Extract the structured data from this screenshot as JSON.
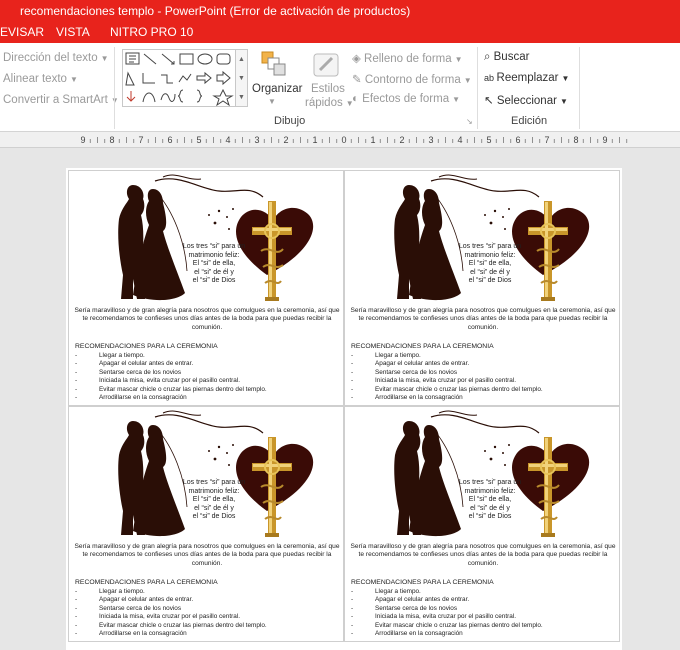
{
  "window": {
    "title": "recomendaciones templo - PowerPoint (Error de activación de productos)"
  },
  "menu": {
    "tabs": [
      "EVISAR",
      "VISTA",
      "NITRO PRO 10"
    ]
  },
  "ribbon": {
    "paragraph": {
      "text_direction": "Dirección del texto",
      "align_text": "Alinear texto",
      "convert_smartart": "Convertir a SmartArt"
    },
    "drawing": {
      "arrange": "Organizar",
      "quick_styles_1": "Estilos",
      "quick_styles_2": "rápidos",
      "shape_fill": "Relleno de forma",
      "shape_outline": "Contorno de forma",
      "shape_effects": "Efectos de forma",
      "group_label": "Dibujo"
    },
    "editing": {
      "find": "Buscar",
      "replace": "Reemplazar",
      "select": "Seleccionar",
      "group_label": "Edición"
    }
  },
  "ruler": {
    "labels": [
      "9",
      "8",
      "7",
      "6",
      "5",
      "4",
      "3",
      "2",
      "1",
      "0",
      "1",
      "2",
      "3",
      "4",
      "5",
      "6",
      "7",
      "8",
      "9"
    ]
  },
  "card": {
    "poem": [
      "Los tres “si” para un",
      "matrimonio feliz:",
      "El “si” de ella,",
      "el “si” de él y",
      "el “si” de Dios"
    ],
    "paragraph": "Sería maravilloso y de gran alegría para nosotros que comulgues en la ceremonia, así que te recomendamos te confieses unos días antes de la boda para que puedas recibir la comunión.",
    "rec_title": "RECOMENDACIONES PARA LA CEREMONIA",
    "recommendations": [
      "Llegar a tiempo.",
      "Apagar el celular antes de entrar.",
      "Sentarse cerca de los novios",
      "Iniciada la misa, evita cruzar por el pasillo central.",
      "Evitar mascar chicle o cruzar las piernas dentro del templo.",
      "Arrodillarse en la consagración"
    ]
  },
  "colors": {
    "titlebar": "#e8231c",
    "silhouette": "#2a0e06",
    "heart": "#3a0b06",
    "gold": "#c9962a"
  }
}
